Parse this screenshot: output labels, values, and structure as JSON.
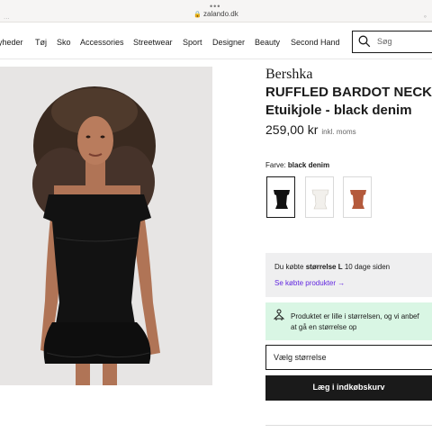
{
  "browser": {
    "url": "zalando.dk",
    "dots": "•••",
    "left_peek": "...",
    "right_peek": "◦"
  },
  "nav": {
    "items": [
      "yheder",
      "Tøj",
      "Sko",
      "Accessories",
      "Streetwear",
      "Sport",
      "Designer",
      "Beauty",
      "Second Hand"
    ],
    "search_placeholder": "Søg"
  },
  "product": {
    "brand": "Bershka",
    "title_line1": "RUFFLED BARDOT NECK",
    "title_line2": "Etuikjole - black denim",
    "price": "259,00 kr",
    "vat_note": "inkl. moms",
    "color_label": "Farve:",
    "color_value": "black denim",
    "swatches": [
      {
        "name": "black",
        "color": "#111111"
      },
      {
        "name": "white",
        "color": "#f2f0ec"
      },
      {
        "name": "rust",
        "color": "#b45a3c"
      }
    ]
  },
  "bought": {
    "text_prefix": "Du købte",
    "size": "størrelse L",
    "text_suffix": "10 dage siden",
    "link": "Se købte produkter →"
  },
  "fit": {
    "line1": "Produktet er lille i størrelsen, og vi anbef",
    "line2": "at gå en størrelse op"
  },
  "actions": {
    "size_select": "Vælg størrelse",
    "add_to_cart": "Læg i indkøbskurv"
  },
  "colors": {
    "accent_link": "#6328e0",
    "fit_bg": "#d9f6e4",
    "bought_bg": "#efeff0"
  }
}
